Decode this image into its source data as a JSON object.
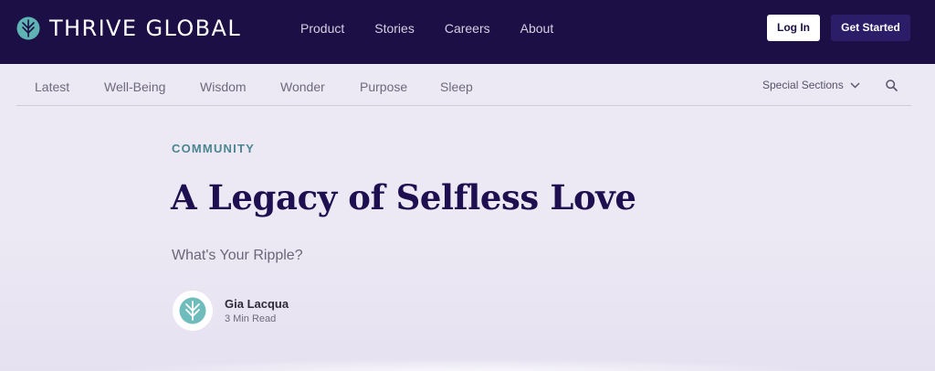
{
  "brand": {
    "name": "THRIVE GLOBAL",
    "icon": "leaf-logo-icon",
    "color": "#5fb3b3"
  },
  "top_nav": [
    "Product",
    "Stories",
    "Careers",
    "About"
  ],
  "auth": {
    "login_label": "Log In",
    "get_started_label": "Get Started"
  },
  "categories": [
    "Latest",
    "Well-Being",
    "Wisdom",
    "Wonder",
    "Purpose",
    "Sleep"
  ],
  "special_sections": {
    "label": "Special Sections",
    "icon": "chevron-down-icon"
  },
  "search": {
    "icon": "search-icon"
  },
  "article": {
    "kicker": "COMMUNITY",
    "title": "A Legacy of Selfless Love",
    "subtitle": "What's Your Ripple?",
    "author": {
      "name": "Gia Lacqua",
      "read_time": "3 Min Read",
      "avatar_icon": "leaf-logo-icon"
    }
  },
  "colors": {
    "header_bg": "#1c0f45",
    "accent_button": "#2c1d69",
    "title": "#1e1050",
    "kicker": "#4b8590",
    "page_bg": "#ebe9f3"
  }
}
